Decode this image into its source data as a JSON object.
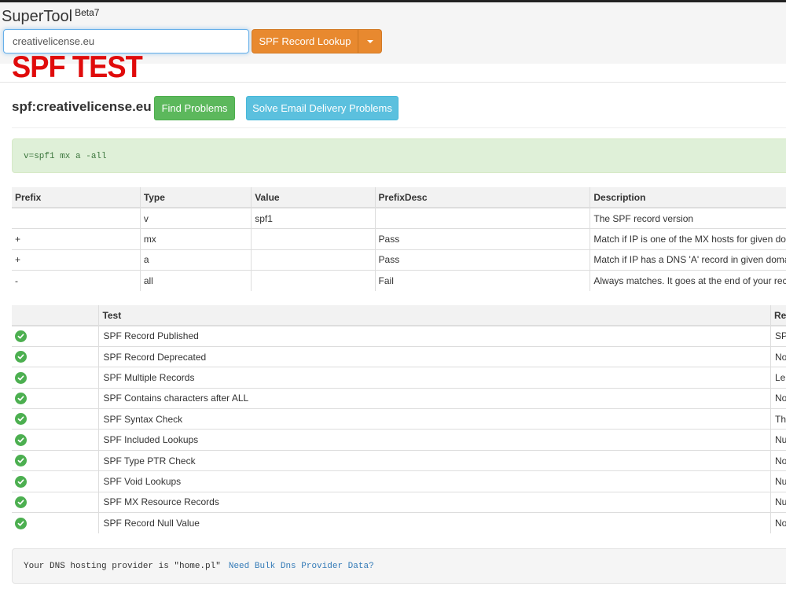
{
  "brand": {
    "name": "SuperTool",
    "version": "Beta7"
  },
  "search": {
    "value": "creativelicense.eu"
  },
  "lookup_button": {
    "label": "SPF Record Lookup"
  },
  "stamp": {
    "text": "SPF TEST"
  },
  "result": {
    "title": "spf:creativelicense.eu",
    "find_problems_label": "Find Problems",
    "solve_label": "Solve Email Delivery Problems",
    "record": "v=spf1 mx a -all"
  },
  "record_table": {
    "headers": [
      "Prefix",
      "Type",
      "Value",
      "PrefixDesc",
      "Description"
    ],
    "rows": [
      [
        "",
        "v",
        "spf1",
        "",
        "The SPF record version"
      ],
      [
        "+",
        "mx",
        "",
        "Pass",
        "Match if IP is one of the MX hosts for given dom"
      ],
      [
        "+",
        "a",
        "",
        "Pass",
        "Match if IP has a DNS 'A' record in given domai"
      ],
      [
        "-",
        "all",
        "",
        "Fail",
        "Always matches. It goes at the end of your reco"
      ]
    ]
  },
  "tests_table": {
    "headers": [
      "",
      "Test",
      "Re"
    ],
    "status_icon": "check-circle-icon",
    "status_color": "#4caf50",
    "rows": [
      [
        "SPF Record Published",
        "SP"
      ],
      [
        "SPF Record Deprecated",
        "No"
      ],
      [
        "SPF Multiple Records",
        "Le"
      ],
      [
        "SPF Contains characters after ALL",
        "No"
      ],
      [
        "SPF Syntax Check",
        "Th"
      ],
      [
        "SPF Included Lookups",
        "Nu"
      ],
      [
        "SPF Type PTR Check",
        "No"
      ],
      [
        "SPF Void Lookups",
        "Nu"
      ],
      [
        "SPF MX Resource Records",
        "Nu"
      ],
      [
        "SPF Record Null Value",
        "No"
      ]
    ]
  },
  "dns": {
    "text": "Your DNS hosting provider is \"home.pl\"",
    "link": "Need Bulk Dns Provider Data?"
  },
  "colors": {
    "accent_orange": "#e8892f",
    "success_green": "#5cb85c",
    "info_blue": "#5bc0de",
    "stamp_red": "#e00b0b"
  }
}
